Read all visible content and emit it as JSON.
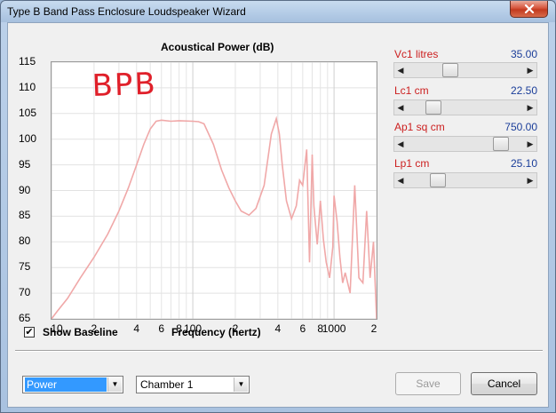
{
  "window": {
    "title": "Type B Band Pass Enclosure Loudspeaker Wizard",
    "close_icon": "close-x-icon"
  },
  "chart": {
    "title": "Acoustical Power (dB)",
    "annotation": "BPB"
  },
  "chart_data": {
    "type": "line",
    "title": "Acoustical Power (dB)",
    "xlabel": "Frequency (hertz)",
    "ylabel": "",
    "x_scale": "log",
    "xlim": [
      10,
      2000
    ],
    "ylim": [
      65,
      115
    ],
    "grid": true,
    "yticks": [
      "115",
      "110",
      "105",
      "100",
      "95",
      "90",
      "85",
      "80",
      "75",
      "70",
      "65"
    ],
    "xticks": [
      "10",
      "2",
      "4",
      "6",
      "8",
      "100",
      "2",
      "4",
      "6",
      "8",
      "1000",
      "2"
    ],
    "color": "#f0a8a8",
    "x": [
      10,
      11,
      13,
      16,
      20,
      25,
      30,
      35,
      40,
      45,
      50,
      55,
      60,
      70,
      80,
      100,
      110,
      120,
      140,
      160,
      180,
      200,
      220,
      250,
      280,
      320,
      360,
      390,
      410,
      430,
      460,
      500,
      540,
      570,
      600,
      640,
      670,
      700,
      720,
      760,
      800,
      840,
      880,
      930,
      980,
      1000,
      1050,
      1100,
      1150,
      1200,
      1300,
      1400,
      1500,
      1600,
      1700,
      1800,
      1900,
      2000
    ],
    "y": [
      65,
      66.5,
      69,
      73,
      77,
      81.5,
      86,
      90.5,
      95,
      99,
      102,
      103.5,
      103.7,
      103.5,
      103.6,
      103.5,
      103.4,
      103,
      99,
      94,
      90.5,
      88,
      86,
      85.2,
      86.5,
      91,
      101,
      104,
      101,
      95,
      88,
      84.5,
      87,
      92,
      91,
      98,
      76,
      97,
      87,
      79.5,
      88,
      80.5,
      76,
      73,
      79,
      89,
      84,
      77,
      72,
      74,
      70,
      91,
      73,
      72,
      86,
      73,
      80,
      65
    ]
  },
  "controls": {
    "show_baseline_label": "Show Baseline",
    "show_baseline_checked": true,
    "check_glyph": "✔",
    "frequency_label": "Frequency (hertz)"
  },
  "sliders": [
    {
      "label": "Vc1  litres",
      "value": "35.00",
      "position": 0.35
    },
    {
      "label": "Lc1  cm",
      "value": "22.50",
      "position": 0.18
    },
    {
      "label": "Ap1  sq cm",
      "value": "750.00",
      "position": 0.85
    },
    {
      "label": "Lp1  cm",
      "value": "25.10",
      "position": 0.23
    }
  ],
  "footer": {
    "mode_combo": "Power",
    "chamber_combo": "Chamber 1",
    "save_label": "Save",
    "cancel_label": "Cancel"
  }
}
